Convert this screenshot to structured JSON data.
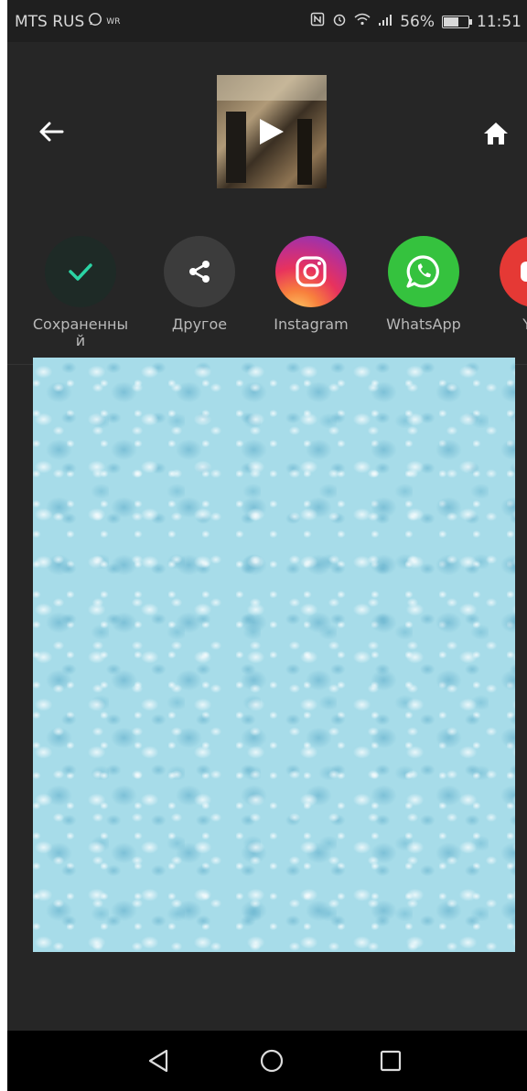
{
  "status_bar": {
    "carrier": "MTS RUS",
    "carrier_extra": "WR",
    "battery": "56%",
    "time": "11:51",
    "battery_level": 0.56
  },
  "toolbar": {
    "back_icon": "arrow-left-icon",
    "home_icon": "home-icon",
    "thumbnail_icon": "play-icon"
  },
  "share_targets": [
    {
      "label": "Сохраненны\nй",
      "icon": "check-icon",
      "color": "#1e2a26"
    },
    {
      "label": "Другое",
      "icon": "share-icon",
      "color": "#3c3c3c"
    },
    {
      "label": "Instagram",
      "icon": "instagram-icon",
      "color": "#e1306c"
    },
    {
      "label": "WhatsApp",
      "icon": "whatsapp-icon",
      "color": "#35c23e"
    },
    {
      "label": "You",
      "icon": "youtube-icon",
      "color": "#e53935"
    }
  ],
  "navbar": {
    "back_icon": "nav-back-icon",
    "home_icon": "nav-home-icon",
    "recents_icon": "nav-recents-icon"
  },
  "colors": {
    "background": "#262626",
    "accent_check": "#2bd4a4"
  }
}
